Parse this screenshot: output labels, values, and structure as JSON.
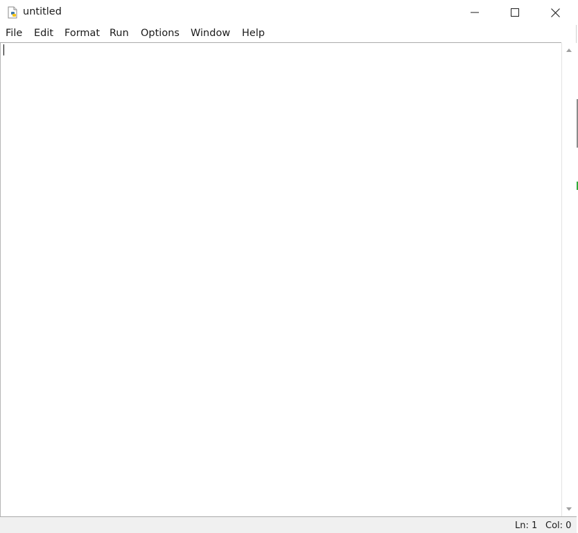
{
  "window": {
    "title": "untitled"
  },
  "menubar": {
    "items": [
      {
        "label": "File"
      },
      {
        "label": "Edit"
      },
      {
        "label": "Format"
      },
      {
        "label": "Run"
      },
      {
        "label": "Options"
      },
      {
        "label": "Window"
      },
      {
        "label": "Help"
      }
    ]
  },
  "editor": {
    "content": ""
  },
  "statusbar": {
    "line": "Ln: 1",
    "col": "Col: 0"
  },
  "icons": {
    "app": "python-file-icon",
    "minimize": "minimize-icon",
    "maximize": "maximize-icon",
    "close": "close-icon",
    "scroll_up": "scroll-up-arrow-icon",
    "scroll_down": "scroll-down-arrow-icon"
  },
  "colors": {
    "python_blue": "#3c78aa",
    "python_yellow": "#f5c518",
    "statusbar_bg": "#f0f0f0"
  }
}
